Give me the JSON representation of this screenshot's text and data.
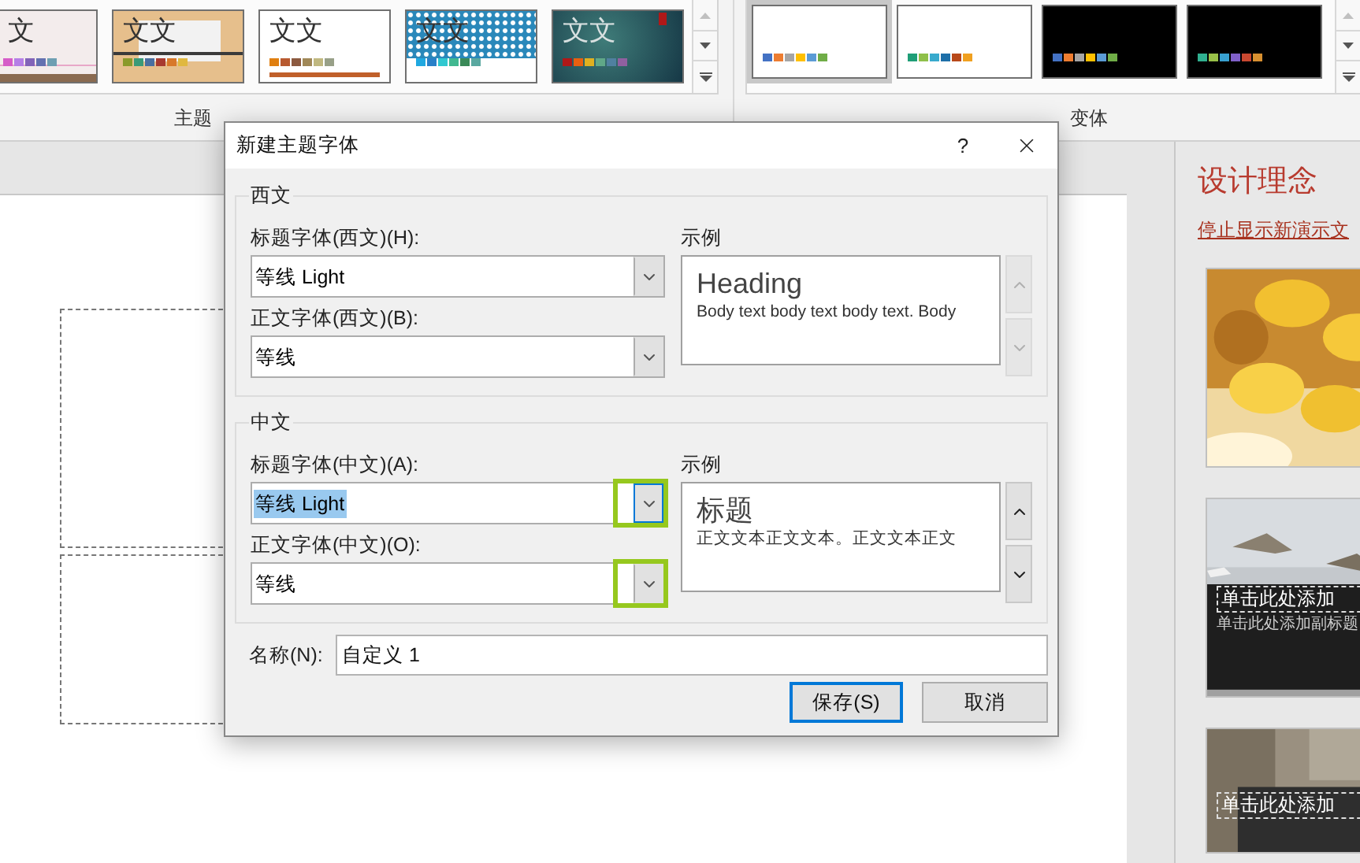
{
  "ribbon": {
    "themes": [
      {
        "kind": "pink",
        "text": "文",
        "swatches": [
          {
            "color": "#d65cc8"
          },
          {
            "color": "#b57fe6"
          },
          {
            "color": "#8263b8"
          },
          {
            "color": "#6371b0"
          },
          {
            "color": "#6e9fb2"
          }
        ]
      },
      {
        "kind": "wood",
        "text": "文文",
        "swatches": [
          {
            "color": "#8a9a2a"
          },
          {
            "color": "#3a9a78"
          },
          {
            "color": "#4a6fa0"
          },
          {
            "color": "#a83a30"
          },
          {
            "color": "#d8782a"
          },
          {
            "color": "#e0b840"
          }
        ]
      },
      {
        "kind": "plain",
        "text": "文文",
        "swatches": [
          {
            "color": "#e07f10"
          },
          {
            "color": "#b85a30"
          },
          {
            "color": "#8c5a40"
          },
          {
            "color": "#a08858"
          },
          {
            "color": "#c0b880"
          },
          {
            "color": "#98a088"
          }
        ]
      },
      {
        "kind": "pattern",
        "text": "文文",
        "swatches": [
          {
            "color": "#20a8e0"
          },
          {
            "color": "#2880c8"
          },
          {
            "color": "#30c8d0"
          },
          {
            "color": "#40b890"
          },
          {
            "color": "#3a8a58"
          },
          {
            "color": "#5aa8a0"
          }
        ]
      },
      {
        "kind": "dark",
        "text": "文文",
        "swatches": [
          {
            "color": "#b01818"
          },
          {
            "color": "#e86010"
          },
          {
            "color": "#e0b020"
          },
          {
            "color": "#60a888"
          },
          {
            "color": "#5080a0"
          },
          {
            "color": "#9060a0"
          }
        ]
      }
    ],
    "themes_label": "主题",
    "variants": [
      {
        "kind": "light",
        "selected": true,
        "swatches": [
          {
            "color": "#4472c4"
          },
          {
            "color": "#ed7d31"
          },
          {
            "color": "#a5a5a5"
          },
          {
            "color": "#ffc000"
          },
          {
            "color": "#5b9bd5"
          },
          {
            "color": "#70ad47"
          }
        ]
      },
      {
        "kind": "light",
        "selected": false,
        "swatches": [
          {
            "color": "#1f9e77"
          },
          {
            "color": "#8fc04a"
          },
          {
            "color": "#38aacd"
          },
          {
            "color": "#1e6fa8"
          },
          {
            "color": "#b8491a"
          },
          {
            "color": "#f0a020"
          }
        ]
      },
      {
        "kind": "black",
        "selected": false,
        "swatches": [
          {
            "color": "#4472c4"
          },
          {
            "color": "#ed7d31"
          },
          {
            "color": "#a5a5a5"
          },
          {
            "color": "#ffc000"
          },
          {
            "color": "#5b9bd5"
          },
          {
            "color": "#70ad47"
          }
        ]
      },
      {
        "kind": "black",
        "selected": false,
        "swatches": [
          {
            "color": "#30b090"
          },
          {
            "color": "#98c048"
          },
          {
            "color": "#38a0d0"
          },
          {
            "color": "#8060c8"
          },
          {
            "color": "#c84830"
          },
          {
            "color": "#d89030"
          }
        ]
      }
    ],
    "variants_label": "变体"
  },
  "dialog": {
    "title": "新建主题字体",
    "help": "?",
    "groups": [
      {
        "title": "西文",
        "fields": [
          {
            "label": "标题字体(西文)(H):",
            "value": "等线 Light",
            "text_selected": false,
            "highlighted": false
          },
          {
            "label": "正文字体(西文)(B):",
            "value": "等线",
            "text_selected": false,
            "highlighted": false
          }
        ],
        "sample_label": "示例",
        "sample_heading": "Heading",
        "sample_body": "Body text body text body text. Body",
        "scroll_disabled": true
      },
      {
        "title": "中文",
        "fields": [
          {
            "label": "标题字体(中文)(A):",
            "value": "等线 Light",
            "text_selected": true,
            "highlighted": true
          },
          {
            "label": "正文字体(中文)(O):",
            "value": "等线",
            "text_selected": false,
            "highlighted": true
          }
        ],
        "sample_label": "示例",
        "sample_heading": "标题",
        "sample_body": "正文文本正文文本。正文文本正文",
        "scroll_disabled": false
      }
    ],
    "name_label": "名称(N):",
    "name_value": "自定义 1",
    "buttons": [
      {
        "label": "保存(S)",
        "default": true
      },
      {
        "label": "取消",
        "default": false
      }
    ]
  },
  "design_pane": {
    "title": "设计理念",
    "link": "停止显示新演示文",
    "cards": [
      {
        "kind": "coins"
      },
      {
        "kind": "birds",
        "title": "单击此处添加",
        "subtitle": "单击此处添加副标题"
      },
      {
        "kind": "paper",
        "title": "单击此处添加"
      }
    ]
  }
}
